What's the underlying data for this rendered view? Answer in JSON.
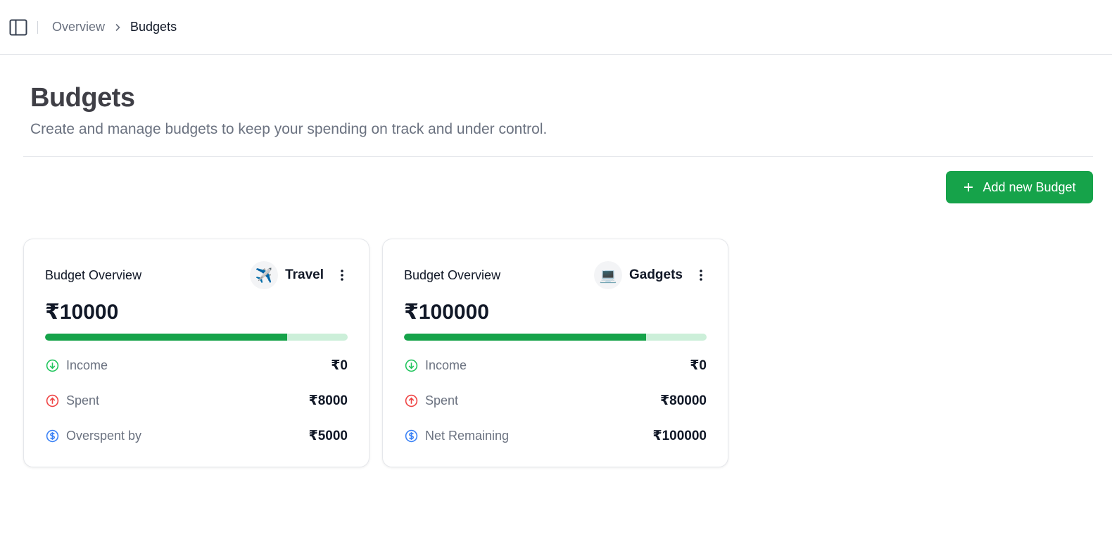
{
  "breadcrumb": {
    "parent": "Overview",
    "current": "Budgets"
  },
  "page": {
    "title": "Budgets",
    "subtitle": "Create and manage budgets to keep your spending on track and under control."
  },
  "actions": {
    "add_budget_label": "Add new Budget"
  },
  "colors": {
    "accent": "#16a34a",
    "income": "#22c55e",
    "spent": "#ef4444",
    "remaining": "#3b82f6"
  },
  "budgets": [
    {
      "title": "Budget Overview",
      "category": "Travel",
      "emoji": "✈️",
      "amount": "₹10000",
      "progress": 0.8,
      "income_label": "Income",
      "income_value": "₹0",
      "spent_label": "Spent",
      "spent_value": "₹8000",
      "balance_label": "Overspent by",
      "balance_value": "₹5000"
    },
    {
      "title": "Budget Overview",
      "category": "Gadgets",
      "emoji": "💻",
      "amount": "₹100000",
      "progress": 0.8,
      "income_label": "Income",
      "income_value": "₹0",
      "spent_label": "Spent",
      "spent_value": "₹80000",
      "balance_label": "Net Remaining",
      "balance_value": "₹100000"
    }
  ]
}
